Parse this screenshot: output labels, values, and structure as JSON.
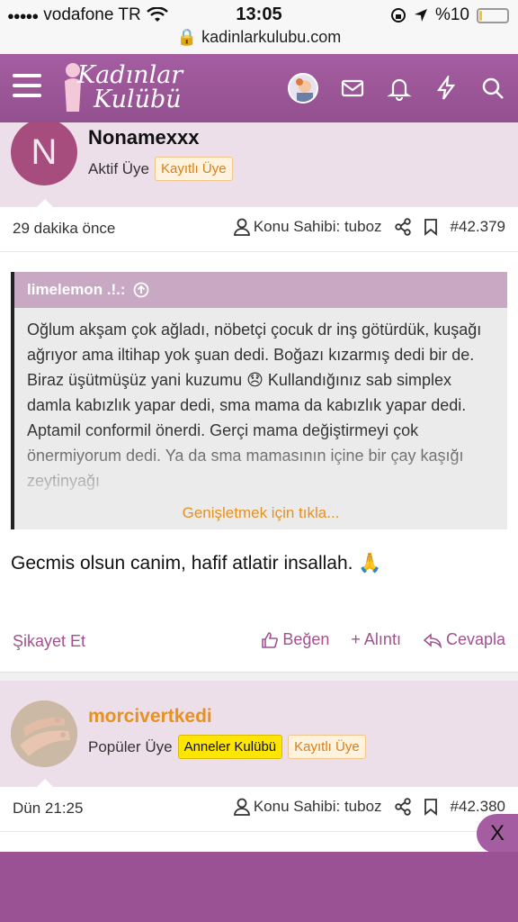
{
  "status_bar": {
    "carrier": "vodafone TR",
    "time": "13:05",
    "battery": "%10",
    "battery_level": 0.1,
    "url": "kadinlarkulubu.com"
  },
  "nav": {
    "logo_line1": "Kadınlar",
    "logo_line2": "Kulübü",
    "icons": [
      "menu-icon",
      "avatar",
      "mail-icon",
      "bell-icon",
      "bolt-icon",
      "search-icon"
    ]
  },
  "post1": {
    "avatar_letter": "N",
    "username": "Nonamexxx",
    "user_title": "Aktif Üye",
    "badges": [
      "Kayıtlı Üye"
    ],
    "time": "29 dakika önce",
    "owner_label": "Konu Sahibi: tuboz",
    "post_number": "#42.379",
    "quote_author": "limelemon .!.:",
    "quote_text": "Oğlum akşam çok ağladı, nöbetçi çocuk dr inş götürdük, kuşağı ağrıyor ama iltihap yok şuan dedi. Boğazı kızarmış dedi bir de. Biraz üşütmüşüz yani kuzumu 😞 Kullandığınız sab simplex damla kabızlık yapar dedi, sma mama da kabızlık yapar dedi. Aptamil conformil önerdi. Gerçi mama değiştirmeyi çok önermiyorum dedi. Ya da sma mamasının içine bir çay kaşığı zeytinyağı",
    "expand_label": "Genişletmek için tıkla...",
    "message": "Gecmis olsun canim, hafif atlatir insallah. 🙏",
    "actions": {
      "report": "Şikayet Et",
      "like": "Beğen",
      "quote": "+ Alıntı",
      "reply": "Cevapla"
    }
  },
  "post2": {
    "username": "morcivertkedi",
    "user_title": "Popüler Üye",
    "badge_primary": "Anneler Kulübü",
    "badge_secondary": "Kayıtlı Üye",
    "time": "Dün 21:25",
    "owner_label": "Konu Sahibi: tuboz",
    "post_number": "#42.380"
  },
  "close_label": "X",
  "colors": {
    "brand": "#9b5295",
    "accent_orange": "#e8911d",
    "header_bg": "#eddfea"
  }
}
